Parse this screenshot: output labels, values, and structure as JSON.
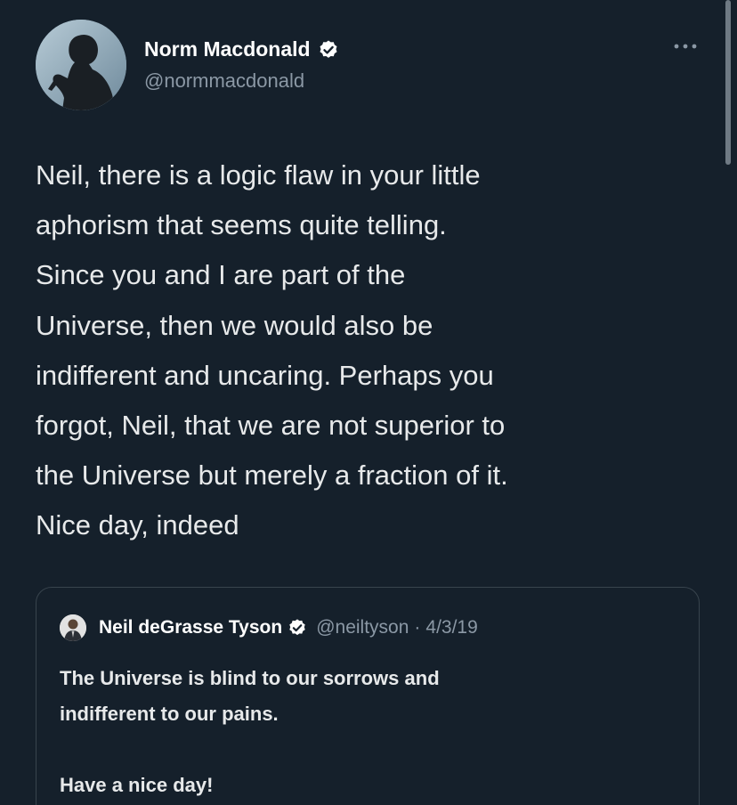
{
  "tweet": {
    "author": {
      "name": "Norm Macdonald",
      "handle": "@normmacdonald",
      "verified": true,
      "avatar": "avatar-silhouette"
    },
    "more_icon": "more-horizontal-icon",
    "text": "Neil, there is a logic flaw in your little\naphorism that seems quite telling.\nSince you and I are part of the\nUniverse, then we would also be\nindifferent and uncaring. Perhaps you\nforgot, Neil, that we are not superior to\nthe Universe but merely a fraction of it.\nNice day, indeed"
  },
  "quoted_tweet": {
    "author": {
      "name": "Neil deGrasse Tyson",
      "handle": "@neiltyson",
      "verified": true
    },
    "separator": "·",
    "date": "4/3/19",
    "text": "The Universe is blind to our sorrows and\nindifferent to our pains.\n\nHave  a nice day!"
  },
  "colors": {
    "background": "#15202b",
    "primary_text": "#e7e9ea",
    "secondary_text": "#8b98a5",
    "border": "#38444d",
    "verified_badge": "#ffffff"
  }
}
